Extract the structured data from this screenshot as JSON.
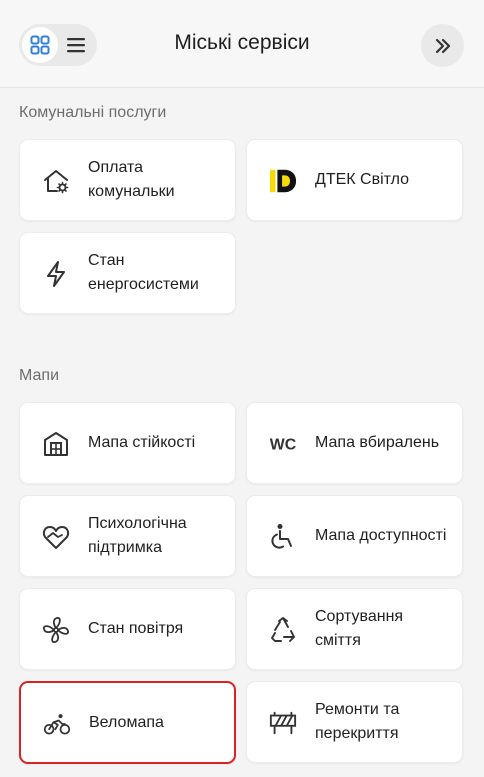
{
  "header": {
    "title": "Міські сервіси",
    "view_toggle": {
      "grid_icon": "grid-icon",
      "list_icon": "list-icon",
      "active": "grid"
    },
    "expand_icon": "double-chevron-right-icon"
  },
  "sections": [
    {
      "title": "Комунальні послуги",
      "items": [
        {
          "label": "Оплата комунальки",
          "icon": "house-gear-icon"
        },
        {
          "label": "ДТЕК Світло",
          "icon": "dtek-logo-icon"
        },
        {
          "label": "Стан енергосистеми",
          "icon": "lightning-icon"
        }
      ]
    },
    {
      "title": "Мапи",
      "items": [
        {
          "label": "Мапа стійкості",
          "icon": "shelter-building-icon"
        },
        {
          "label": "Мапа вбиралень",
          "icon": "wc-icon"
        },
        {
          "label": "Психологічна підтримка",
          "icon": "heart-handshake-icon"
        },
        {
          "label": "Мапа доступності",
          "icon": "wheelchair-icon"
        },
        {
          "label": "Стан повітря",
          "icon": "fan-icon"
        },
        {
          "label": "Сортування сміття",
          "icon": "recycle-icon"
        },
        {
          "label": "Веломапа",
          "icon": "bicycle-icon",
          "highlighted": true
        },
        {
          "label": "Ремонти та перекриття",
          "icon": "road-barrier-icon"
        }
      ]
    }
  ],
  "colors": {
    "highlight": "#d62424",
    "dtek_yellow": "#f5d90a",
    "grid_icon_blue": "#2f7fd6"
  }
}
